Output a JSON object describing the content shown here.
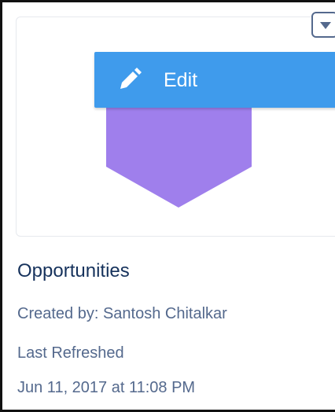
{
  "card": {
    "menu": {
      "toggle_icon": "caret-down-icon",
      "edit_label": "Edit",
      "edit_icon": "pencil-icon"
    },
    "thumbnail": {
      "shape_color": "#9f7fec"
    },
    "title": "Opportunities",
    "created_by": "Created by: Santosh Chitalkar",
    "last_refreshed_label": "Last Refreshed",
    "last_refreshed_value": "Jun 11, 2017 at 11:08 PM"
  },
  "colors": {
    "menu_accent": "#3f9bec",
    "title_text": "#16325c",
    "meta_text": "#54698d"
  }
}
